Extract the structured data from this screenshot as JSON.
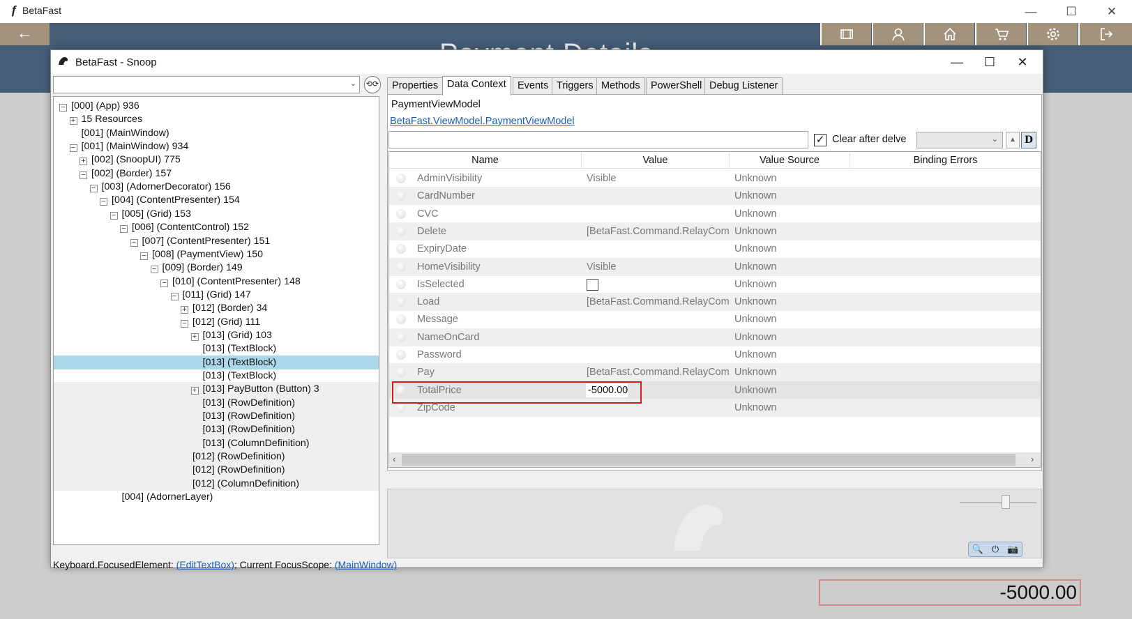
{
  "app": {
    "title": "BetaFast",
    "logo_glyph": "ƒ",
    "window_controls": {
      "minimize": "—",
      "maximize": "☐",
      "close": "✕"
    },
    "back_glyph": "←",
    "page_title": "Payment Details",
    "nav_icons": [
      "reader-icon",
      "user-icon",
      "home-icon",
      "cart-icon",
      "settings-icon",
      "logout-icon"
    ],
    "total_price_display": "-5000.00",
    "colors": {
      "header": "#455d77",
      "nav_button": "#a3937c"
    }
  },
  "snoop": {
    "title": "BetaFast - Snoop",
    "window_controls": {
      "minimize": "—",
      "maximize": "☐",
      "close": "✕"
    },
    "filter_dropdown_glyph": "⌄",
    "tree": [
      {
        "text": "[000]  (App) 936",
        "exp": "−"
      },
      {
        "text": "15 Resources",
        "exp": "+"
      },
      {
        "text": "[001]  (MainWindow)",
        "exp": ""
      },
      {
        "text": "[001]  (MainWindow) 934",
        "exp": "−"
      },
      {
        "text": "[002]  (SnoopUI) 775",
        "exp": "+"
      },
      {
        "text": "[002]  (Border) 157",
        "exp": "−"
      },
      {
        "text": "[003]  (AdornerDecorator) 156",
        "exp": "−"
      },
      {
        "text": "[004]  (ContentPresenter) 154",
        "exp": "−"
      },
      {
        "text": "[005]  (Grid) 153",
        "exp": "−"
      },
      {
        "text": "[006]  (ContentControl) 152",
        "exp": "−"
      },
      {
        "text": "[007]  (ContentPresenter) 151",
        "exp": "−"
      },
      {
        "text": "[008]  (PaymentView) 150",
        "exp": "−"
      },
      {
        "text": "[009]  (Border) 149",
        "exp": "−"
      },
      {
        "text": "[010]  (ContentPresenter) 148",
        "exp": "−"
      },
      {
        "text": "[011]  (Grid) 147",
        "exp": "−"
      },
      {
        "text": "[012]  (Border) 34",
        "exp": "+"
      },
      {
        "text": "[012]  (Grid) 111",
        "exp": "−"
      },
      {
        "text": "[013]  (Grid) 103",
        "exp": "+"
      },
      {
        "text": "[013]  (TextBlock)",
        "exp": ""
      },
      {
        "text": "[013]  (TextBlock)",
        "exp": ""
      },
      {
        "text": "[013]  (TextBlock)",
        "exp": ""
      },
      {
        "text": "[013] PayButton (Button) 3",
        "exp": "+"
      },
      {
        "text": "[013]  (RowDefinition)",
        "exp": ""
      },
      {
        "text": "[013]  (RowDefinition)",
        "exp": ""
      },
      {
        "text": "[013]  (RowDefinition)",
        "exp": ""
      },
      {
        "text": "[013]  (ColumnDefinition)",
        "exp": ""
      },
      {
        "text": "[012]  (RowDefinition)",
        "exp": ""
      },
      {
        "text": "[012]  (RowDefinition)",
        "exp": ""
      },
      {
        "text": "[012]  (ColumnDefinition)",
        "exp": ""
      },
      {
        "text": "[004]  (AdornerLayer)",
        "exp": ""
      }
    ],
    "status": {
      "prefix": "Keyboard.FocusedElement: ",
      "focused_link": "(EditTextBox)",
      "middle": "; Current FocusScope: ",
      "scope_link": "(MainWindow)"
    },
    "tabs": [
      "Properties",
      "Data Context",
      "Events",
      "Triggers",
      "Methods",
      "PowerShell",
      "Debug Listener"
    ],
    "active_tab": "Data Context",
    "data_context": {
      "vm_name": "PaymentViewModel",
      "vm_type": "BetaFast.ViewModel.PaymentViewModel",
      "delve_placeholder": "",
      "clear_after_delve": "Clear after delve",
      "clear_checked": "✓",
      "combo_glyph": "⌄",
      "up_glyph": "▲",
      "d_button": "D",
      "columns": [
        "Name",
        "Value",
        "Value Source",
        "Binding Errors"
      ],
      "rows": [
        {
          "name": "AdminVisibility",
          "value": "Visible",
          "source": "Unknown"
        },
        {
          "name": "CardNumber",
          "value": "",
          "source": "Unknown"
        },
        {
          "name": "CVC",
          "value": "",
          "source": "Unknown"
        },
        {
          "name": "Delete",
          "value": "[BetaFast.Command.RelayCommand]",
          "source": "Unknown"
        },
        {
          "name": "ExpiryDate",
          "value": "",
          "source": "Unknown"
        },
        {
          "name": "HomeVisibility",
          "value": "Visible",
          "source": "Unknown"
        },
        {
          "name": "IsSelected",
          "value": "",
          "source": "Unknown",
          "checkbox": true
        },
        {
          "name": "Load",
          "value": "[BetaFast.Command.RelayCommand]",
          "source": "Unknown"
        },
        {
          "name": "Message",
          "value": "",
          "source": "Unknown"
        },
        {
          "name": "NameOnCard",
          "value": "",
          "source": "Unknown"
        },
        {
          "name": "Password",
          "value": "",
          "source": "Unknown"
        },
        {
          "name": "Pay",
          "value": "[BetaFast.Command.RelayCommand]",
          "source": "Unknown"
        },
        {
          "name": "TotalPrice",
          "value": "-5000.00",
          "source": "Unknown",
          "editing": true
        },
        {
          "name": "ZipCode",
          "value": "",
          "source": "Unknown"
        }
      ],
      "scroll_left": "‹",
      "scroll_right": "›"
    },
    "preview_buttons": [
      "🔍",
      "⏻",
      "📷"
    ]
  }
}
